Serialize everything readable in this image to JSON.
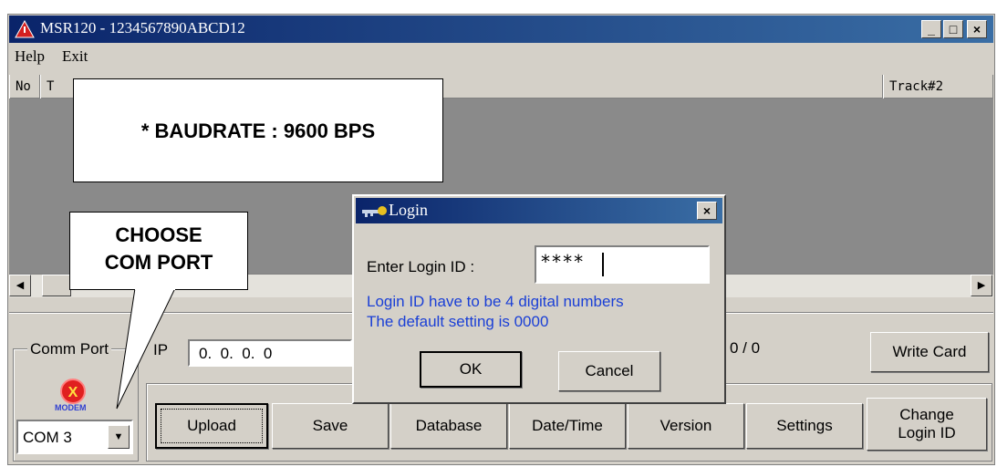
{
  "window": {
    "title": "MSR120  -  1234567890ABCD12",
    "buttons": {
      "minimize": "_",
      "maximize": "□",
      "close": "×"
    }
  },
  "menu": {
    "help": "Help",
    "exit": "Exit"
  },
  "list": {
    "col_no": "No",
    "col_t": "T",
    "col_track2": "Track#2"
  },
  "scrollbar": {
    "left": "◀",
    "right": "▶"
  },
  "comm": {
    "group_label": "Comm Port",
    "modem_icon_text": "MODEM",
    "port_value": "COM 3",
    "dropdown_arrow": "▼"
  },
  "ip": {
    "label": "IP",
    "value": "0.  0.  0.  0"
  },
  "counter": "0 / 0",
  "buttons": {
    "write_card": "Write Card",
    "upload": "Upload",
    "save": "Save",
    "database": "Database",
    "datetime": "Date/Time",
    "version": "Version",
    "settings": "Settings",
    "change_login_1": "Change",
    "change_login_2": "Login ID"
  },
  "dialog": {
    "title": "Login",
    "close": "×",
    "prompt": "Enter Login ID :",
    "value": "****",
    "hint1": "Login ID have to be 4 digital numbers",
    "hint2": "The default setting is 0000",
    "ok": "OK",
    "cancel": "Cancel"
  },
  "callouts": {
    "baudrate": "* BAUDRATE : 9600 BPS",
    "com_line1": "CHOOSE",
    "com_line2": "COM PORT"
  },
  "colors": {
    "title_active": "#0a246a",
    "hint_text": "#1a3fd6",
    "face": "#d4d0c8"
  }
}
